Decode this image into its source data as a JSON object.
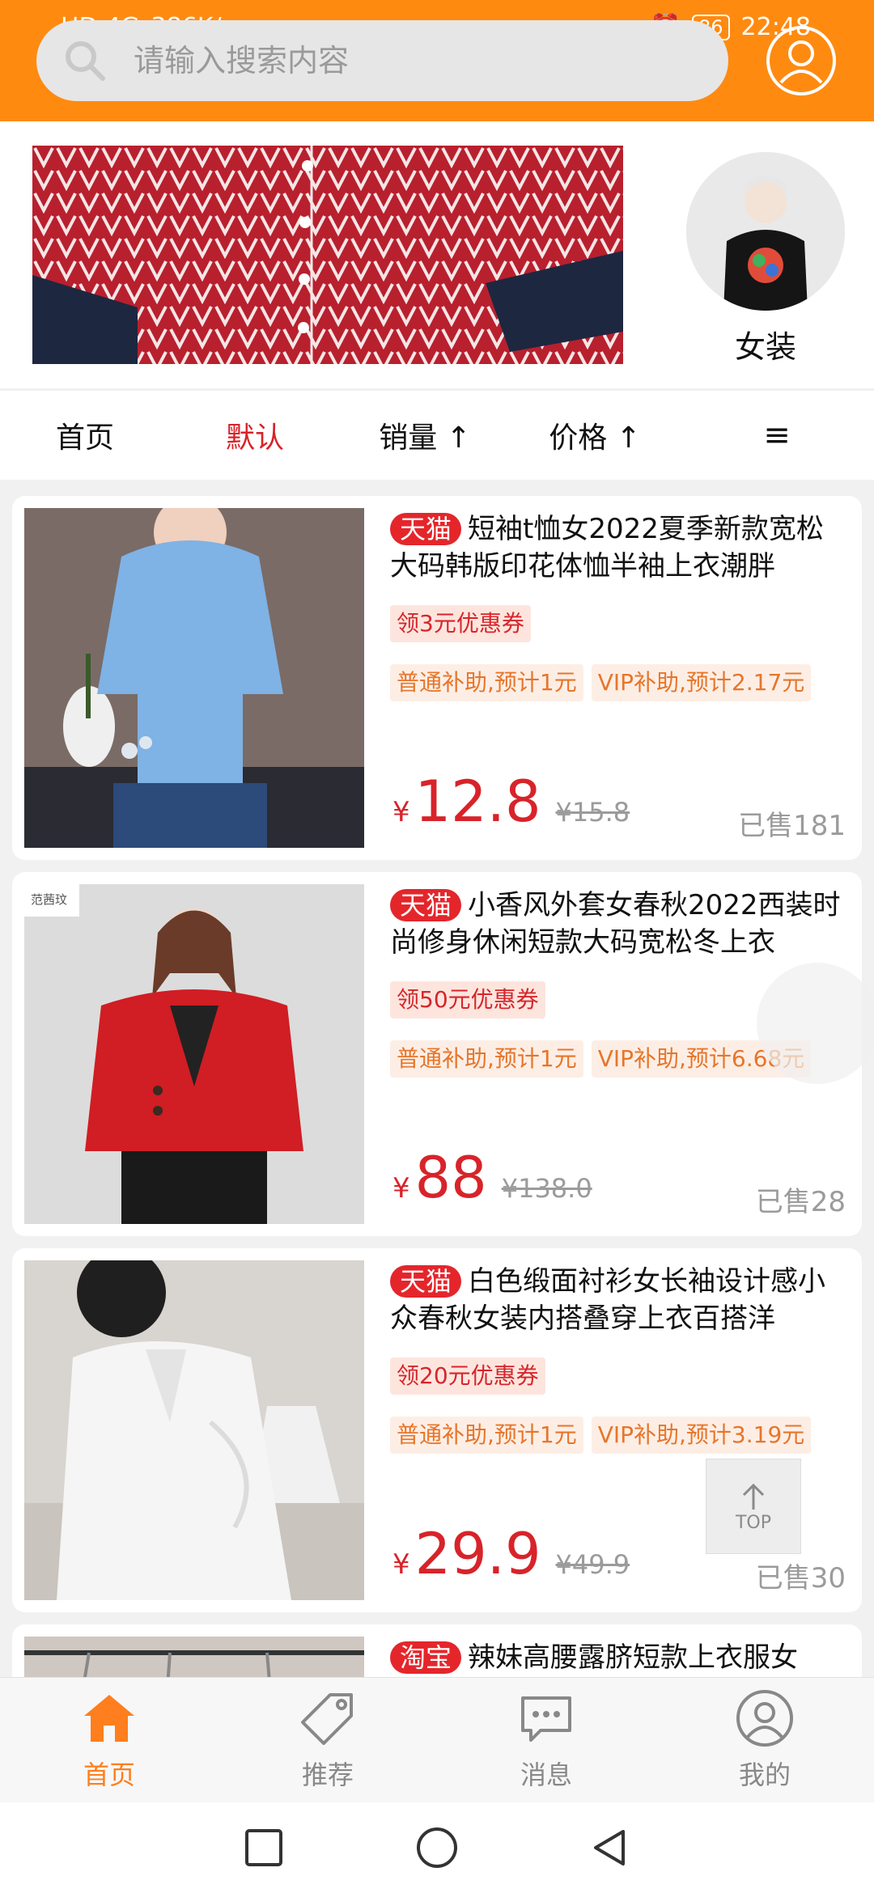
{
  "status_bar": {
    "left_signal": "HD 4G",
    "speed": "386K/s",
    "battery": "86",
    "time": "22:48"
  },
  "search": {
    "placeholder": "请输入搜索内容"
  },
  "banner": {
    "category_label": "女装"
  },
  "sort_tabs": [
    {
      "label": "首页"
    },
    {
      "label": "默认"
    },
    {
      "label": "销量 ↑"
    },
    {
      "label": "价格 ↑"
    },
    {
      "label": "≡"
    }
  ],
  "products": [
    {
      "badge": "天猫",
      "title": "短袖t恤女2022夏季新款宽松大码韩版印花体恤半袖上衣潮胖",
      "coupon": "领3元优惠券",
      "subsidy_normal": "普通补助,预计1元",
      "subsidy_vip": "VIP补助,预计2.17元",
      "currency": "¥",
      "price": "12.8",
      "original_price": "¥15.8",
      "sold": "已售181"
    },
    {
      "badge": "天猫",
      "title": "小香风外套女春秋2022西装时尚修身休闲短款大码宽松冬上衣",
      "coupon": "领50元优惠券",
      "subsidy_normal": "普通补助,预计1元",
      "subsidy_vip": "VIP补助,预计6.68元",
      "currency": "¥",
      "price": "88",
      "original_price": "¥138.0",
      "sold": "已售28",
      "thumb_logo": "范茜玟"
    },
    {
      "badge": "天猫",
      "title": "白色缎面衬衫女长袖设计感小众春秋女装内搭叠穿上衣百搭洋",
      "coupon": "领20元优惠券",
      "subsidy_normal": "普通补助,预计1元",
      "subsidy_vip": "VIP补助,预计3.19元",
      "currency": "¥",
      "price": "29.9",
      "original_price": "¥49.9",
      "sold": "已售30"
    },
    {
      "badge": "淘宝",
      "title": "辣妹高腰露脐短款上衣服女"
    }
  ],
  "top_button": {
    "label": "TOP"
  },
  "bottom_nav": [
    {
      "label": "首页",
      "icon": "home-icon",
      "active": true
    },
    {
      "label": "推荐",
      "icon": "tag-icon"
    },
    {
      "label": "消息",
      "icon": "message-icon"
    },
    {
      "label": "我的",
      "icon": "user-icon"
    }
  ],
  "colors": {
    "brand_orange": "#ff8a10",
    "price_red": "#d8232a",
    "nav_active": "#ff7e1d"
  }
}
